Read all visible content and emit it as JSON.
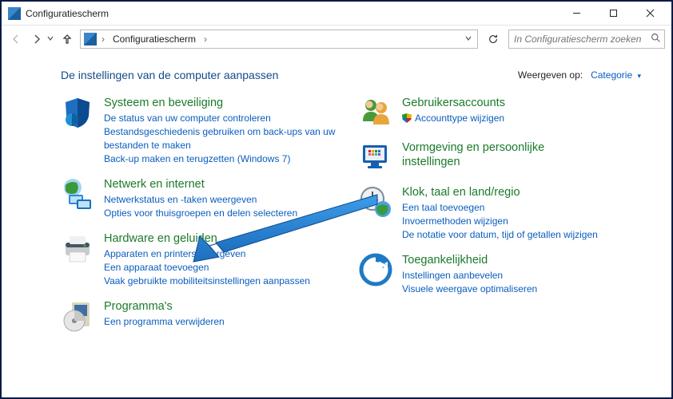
{
  "window": {
    "title": "Configuratiescherm"
  },
  "toolbar": {
    "addressbar": {
      "root": "Configuratiescherm"
    },
    "search_placeholder": "In Configuratiescherm zoeken"
  },
  "header": {
    "heading": "De instellingen van de computer aanpassen",
    "viewby_label": "Weergeven op:",
    "viewby_value": "Categorie"
  },
  "left": {
    "system": {
      "title": "Systeem en beveiliging",
      "l1": "De status van uw computer controleren",
      "l2": "Bestandsgeschiedenis gebruiken om back-ups van uw bestanden te maken",
      "l3": "Back-up maken en terugzetten (Windows 7)"
    },
    "network": {
      "title": "Netwerk en internet",
      "l1": "Netwerkstatus en -taken weergeven",
      "l2": "Opties voor thuisgroepen en delen selecteren"
    },
    "hardware": {
      "title": "Hardware en geluiden",
      "l1": "Apparaten en printers weergeven",
      "l2": "Een apparaat toevoegen",
      "l3": "Vaak gebruikte mobiliteitsinstellingen aanpassen"
    },
    "programs": {
      "title": "Programma's",
      "l1": "Een programma verwijderen"
    }
  },
  "right": {
    "accounts": {
      "title": "Gebruikersaccounts",
      "l1": "Accounttype wijzigen"
    },
    "appearance": {
      "title": "Vormgeving en persoonlijke instellingen"
    },
    "clock": {
      "title": "Klok, taal en land/regio",
      "l1": "Een taal toevoegen",
      "l2": "Invoermethoden wijzigen",
      "l3": "De notatie voor datum, tijd of getallen wijzigen"
    },
    "access": {
      "title": "Toegankelijkheid",
      "l1": "Instellingen aanbevelen",
      "l2": "Visuele weergave optimaliseren"
    }
  }
}
